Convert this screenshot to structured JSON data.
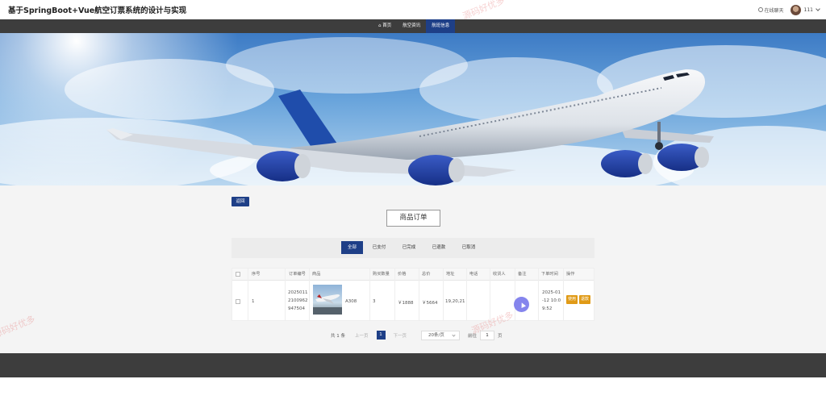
{
  "header": {
    "title": "基于SpringBoot+Vue航空订票系统的设计与实现",
    "cs_label": "在线聊天",
    "username": "111"
  },
  "nav": {
    "items": [
      {
        "label": "首页"
      },
      {
        "label": "航空资讯"
      },
      {
        "label": "航班信息"
      }
    ],
    "active_index": 2
  },
  "main": {
    "back_label": "返回",
    "page_title": "商品订单",
    "tabs": [
      "全部",
      "已支付",
      "已完成",
      "已退款",
      "已取消"
    ],
    "active_tab": 0
  },
  "table": {
    "headers": [
      "序号",
      "订单编号",
      "商品",
      "购买数量",
      "价格",
      "总价",
      "地址",
      "电话",
      "收货人",
      "备注",
      "下单时间",
      "操作"
    ],
    "rows": [
      {
        "index": "1",
        "order_no_lines": [
          "2025011",
          "2100962",
          "947504"
        ],
        "product_name": "A308",
        "quantity": "3",
        "price": "￥1888",
        "total": "￥5664",
        "address": "19,20,21",
        "phone": "",
        "receiver": "",
        "remark": "",
        "time_lines": [
          "2025-01",
          "-12 10:0",
          "9:52"
        ],
        "actions": [
          "使用",
          "退款"
        ]
      }
    ]
  },
  "pagination": {
    "total": "共 1 条",
    "prev": "上一页",
    "current": "1",
    "next": "下一页",
    "page_size": "20条/页",
    "goto_label": "前往",
    "goto_value": "1",
    "page_unit": "页"
  },
  "watermark": "源码好优多",
  "colors": {
    "primary": "#1e3f87",
    "nav_bg": "#3d3d3d",
    "action": "#e09a16"
  }
}
